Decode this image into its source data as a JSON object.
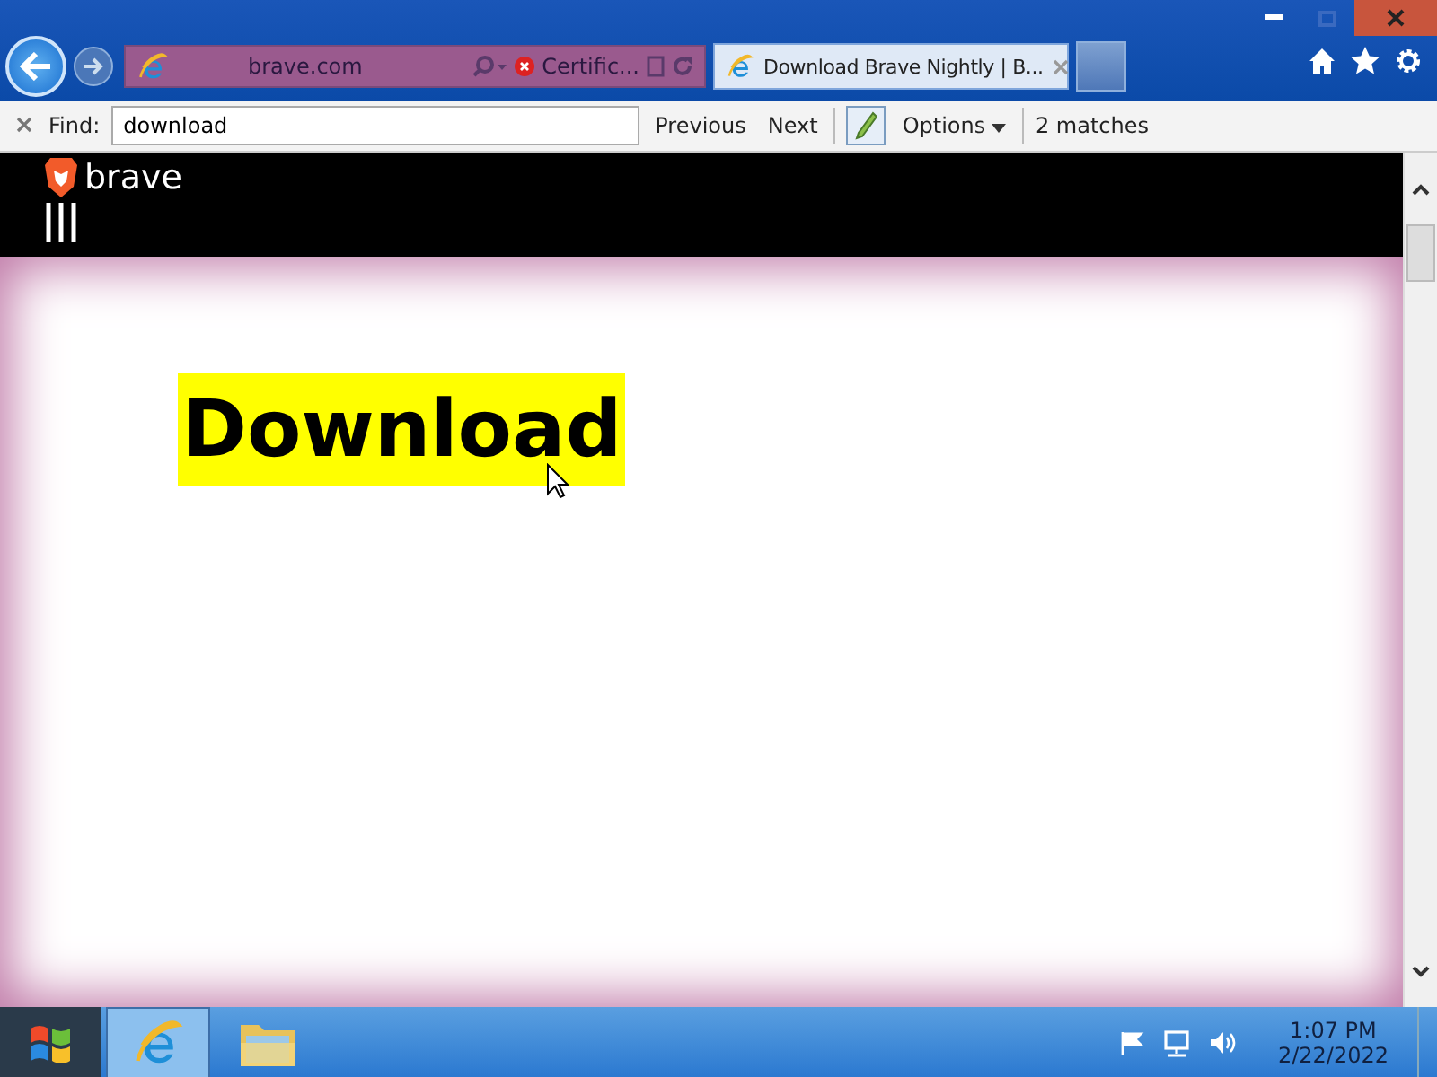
{
  "address_bar": {
    "url": "brave.com",
    "certificate": "Certific..."
  },
  "tabs": [
    {
      "title": "Download Brave Nightly | B...",
      "selected": true
    }
  ],
  "find_bar": {
    "label": "Find:",
    "value": "download",
    "previous": "Previous",
    "next": "Next",
    "options": "Options",
    "matches": "2 matches"
  },
  "page": {
    "brand": "brave",
    "heading": "Download",
    "highlighted": true
  },
  "taskbar": {
    "items": [
      {
        "kind": "browser",
        "selected": true
      },
      {
        "kind": "folder",
        "selected": false
      }
    ],
    "time": "1:07 PM",
    "date": "2/22/2022"
  }
}
